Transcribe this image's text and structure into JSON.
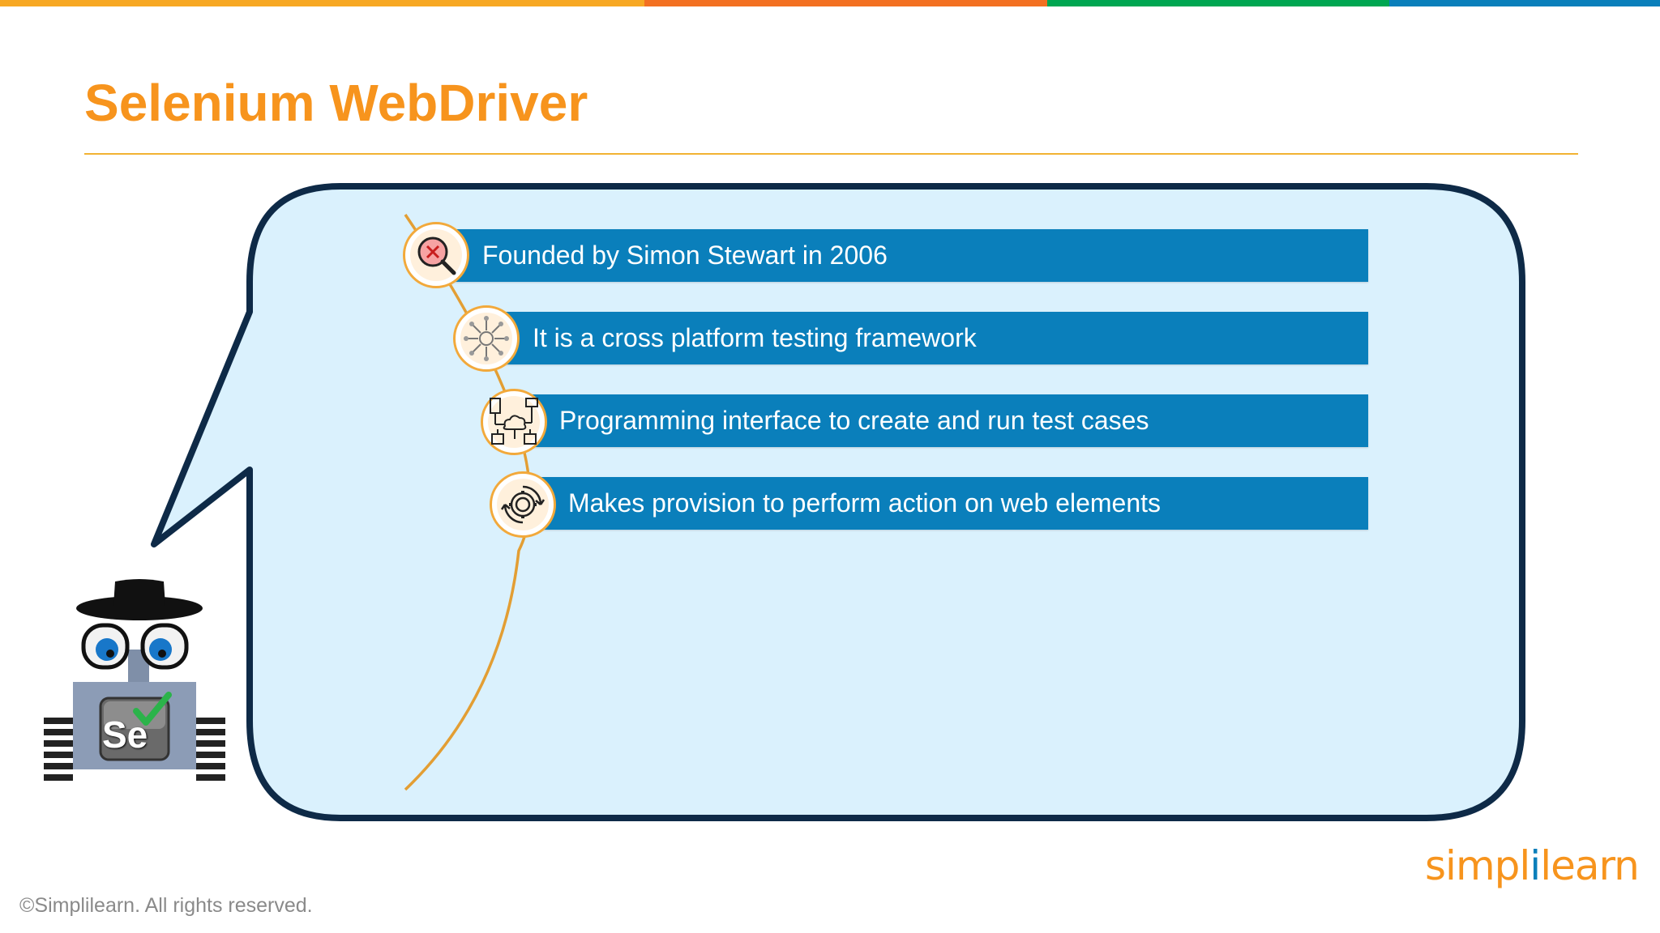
{
  "colors": {
    "title": "#f7941d",
    "bar": "#0a7fbb",
    "bubble_fill": "#daf1fd",
    "bubble_stroke": "#0e2a47",
    "timeline": "#e39e33",
    "top_stripes": [
      "#f7a823",
      "#f37021",
      "#00a651",
      "#0a7fbb"
    ]
  },
  "slide": {
    "title": "Selenium WebDriver"
  },
  "points": [
    {
      "text": "Founded by Simon Stewart in 2006",
      "icon": "magnifier-x-icon"
    },
    {
      "text": "It is a cross platform testing framework",
      "icon": "network-gear-icon"
    },
    {
      "text": "Programming interface to create and run test cases",
      "icon": "cloud-devices-icon"
    },
    {
      "text": "Makes provision to perform action on web elements",
      "icon": "gear-cycle-icon"
    }
  ],
  "mascot": {
    "badge_text": "Se"
  },
  "footer": {
    "copyright": "©Simplilearn. All rights reserved.",
    "logo_part1": "simpl",
    "logo_part2": "i",
    "logo_part3": "learn"
  }
}
